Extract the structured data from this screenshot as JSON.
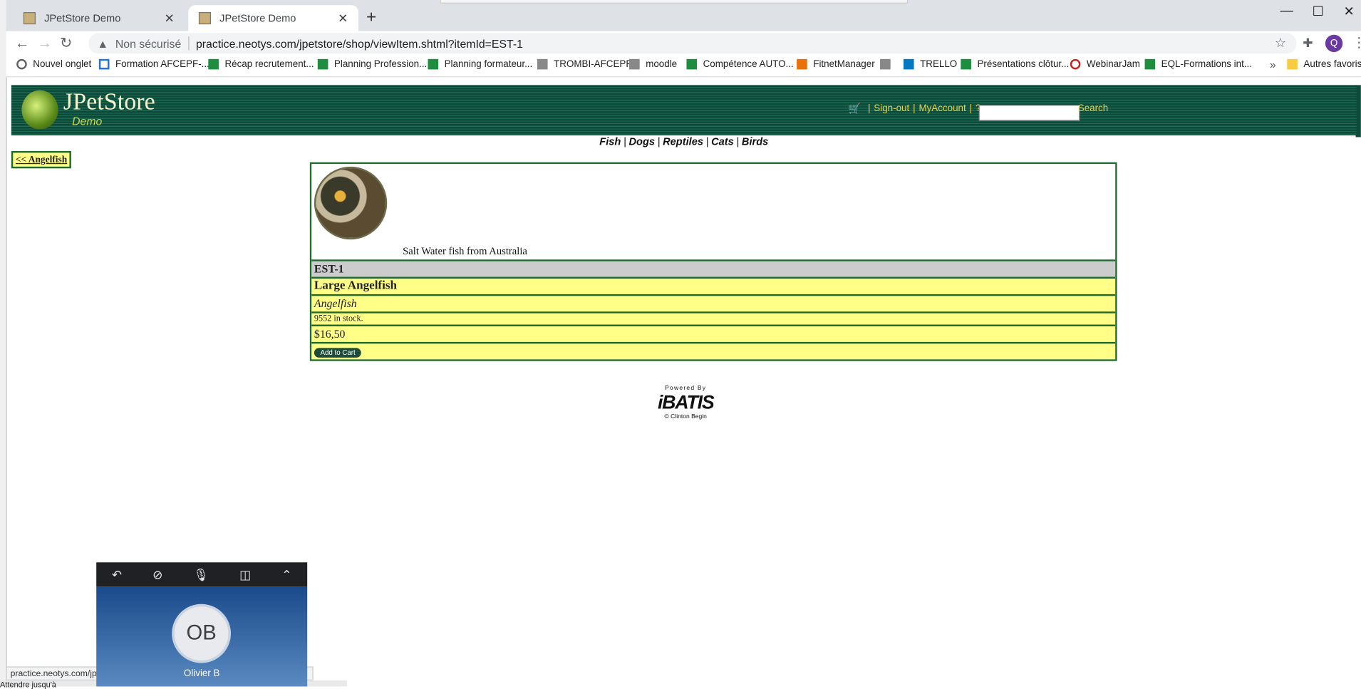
{
  "browser": {
    "tabs": [
      {
        "title": "JPetStore Demo",
        "active": false
      },
      {
        "title": "JPetStore Demo",
        "active": true
      }
    ],
    "new_tab": "+",
    "window_controls": {
      "minimize": "—",
      "maximize": "☐",
      "close": "✕"
    },
    "security_label": "Non sécurisé",
    "url": "practice.neotys.com/jpetstore/shop/viewItem.shtml?itemId=EST-1",
    "profile_initial": "Q",
    "bookmarks": [
      {
        "label": "Nouvel onglet",
        "icon": "globe"
      },
      {
        "label": "Formation AFCEPF-...",
        "icon": "blue"
      },
      {
        "label": "Récap recrutement...",
        "icon": "green"
      },
      {
        "label": "Planning Profession...",
        "icon": "green"
      },
      {
        "label": "Planning formateur...",
        "icon": "green"
      },
      {
        "label": "TROMBI-AFCEPF",
        "icon": "gray"
      },
      {
        "label": "moodle",
        "icon": "gray"
      },
      {
        "label": "Compétence AUTO...",
        "icon": "green"
      },
      {
        "label": "FitnetManager",
        "icon": "orange"
      },
      {
        "label": "",
        "icon": "gray"
      },
      {
        "label": "TRELLO",
        "icon": "trello"
      },
      {
        "label": "Présentations clôtur...",
        "icon": "green"
      },
      {
        "label": "WebinarJam",
        "icon": "red"
      },
      {
        "label": "EQL-Formations int...",
        "icon": "green"
      }
    ],
    "bookmarks_more": "»",
    "other_bookmarks": "Autres favoris"
  },
  "store": {
    "brand": "JPetStore",
    "brand_sub": "Demo",
    "menu": {
      "signout": "Sign-out",
      "account": "MyAccount",
      "help": "?",
      "search": "Search",
      "search_value": ""
    },
    "categories": [
      "Fish",
      "Dogs",
      "Reptiles",
      "Cats",
      "Birds"
    ],
    "back_link": "<< Angelfish",
    "item": {
      "description": "Salt Water fish from Australia",
      "id": "EST-1",
      "name": "Large Angelfish",
      "product": "Angelfish",
      "stock": "9552 in stock.",
      "price": "$16,50",
      "add_to_cart": "Add to Cart"
    },
    "powered_by": "Powered By",
    "ibatis": "iBATIS",
    "ibatis_credit": "© Clinton Begin"
  },
  "status_bar": "practice.neotys.com/jpe",
  "underlying_text": "Attendre jusqu'à",
  "call": {
    "initials": "OB",
    "name": "Olivier B"
  }
}
